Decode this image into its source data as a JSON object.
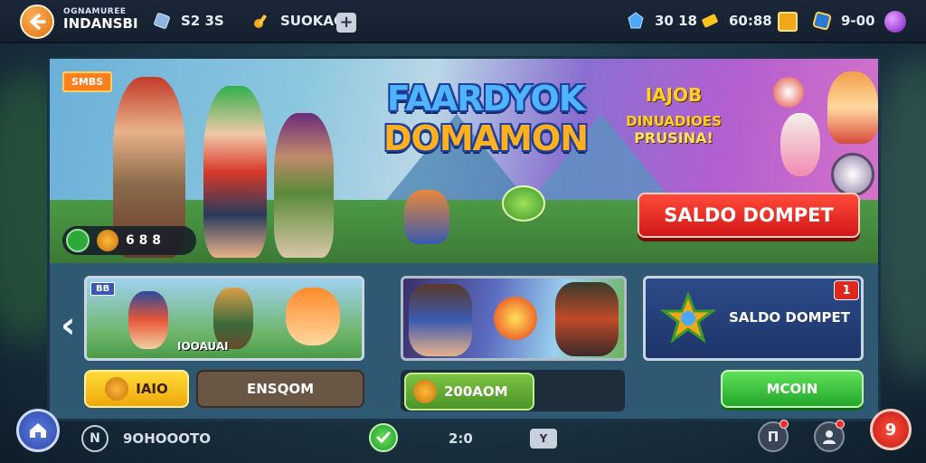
{
  "header": {
    "subtitle": "OGNAMUREE",
    "title": "INDANSBI",
    "resource_left_1": "S2 3S",
    "resource_left_2": "SUOKAO",
    "resource_right_1": "30 18",
    "resource_right_2": "60:88",
    "resource_right_3": "9-00"
  },
  "banner": {
    "tag": "SMBS",
    "game_title_line1": "FAARDYOK",
    "game_title_line2": "DOMAMON",
    "promo_line1": "IAJOB",
    "promo_line2": "DINUADIOES",
    "promo_line3": "PRUSINA!",
    "wallet_button": "SALDO DOMPET",
    "stat_value": "6 8  8"
  },
  "cards": {
    "card1_tag": "BB",
    "card1_caption": "IOOAUAI",
    "card3_label": "SALDO DOMPET",
    "card3_badge": "1"
  },
  "buttons": {
    "join": "IAIO",
    "ensqom": "ENSQOM",
    "coins": "200AOM",
    "main": "MCOIN"
  },
  "bottom": {
    "n_label": "N",
    "left_text": "9OHOOOTO",
    "center_text": "2:0",
    "small_btn": "Y",
    "icon1": "П",
    "nine": "9"
  },
  "colors": {
    "primary_red": "#d21818",
    "primary_green": "#22a82a",
    "accent_orange": "#ff7f1f",
    "panel": "#2f5872"
  }
}
